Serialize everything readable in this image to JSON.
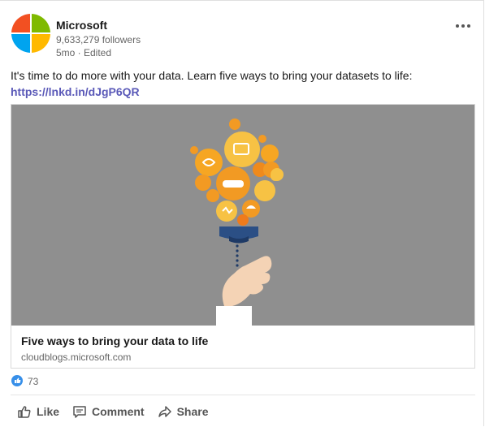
{
  "post": {
    "author": "Microsoft",
    "followers": "9,633,279 followers",
    "meta": "5mo · Edited",
    "text": "It's time to do more with your data. Learn five ways to bring your datasets to life:",
    "link": "https://lnkd.in/dJgP6QR"
  },
  "media": {
    "title": "Five ways to bring your data to life",
    "domain": "cloudblogs.microsoft.com",
    "background_color": "#8f8f8f"
  },
  "reactions": {
    "count": "73",
    "icon": "like-reaction-icon"
  },
  "actions": {
    "like": "Like",
    "comment": "Comment",
    "share": "Share"
  },
  "colors": {
    "link": "#5a59b8",
    "logo_red": "#f25022",
    "logo_green": "#7fba00",
    "logo_blue": "#00a4ef",
    "logo_yellow": "#ffb900"
  }
}
